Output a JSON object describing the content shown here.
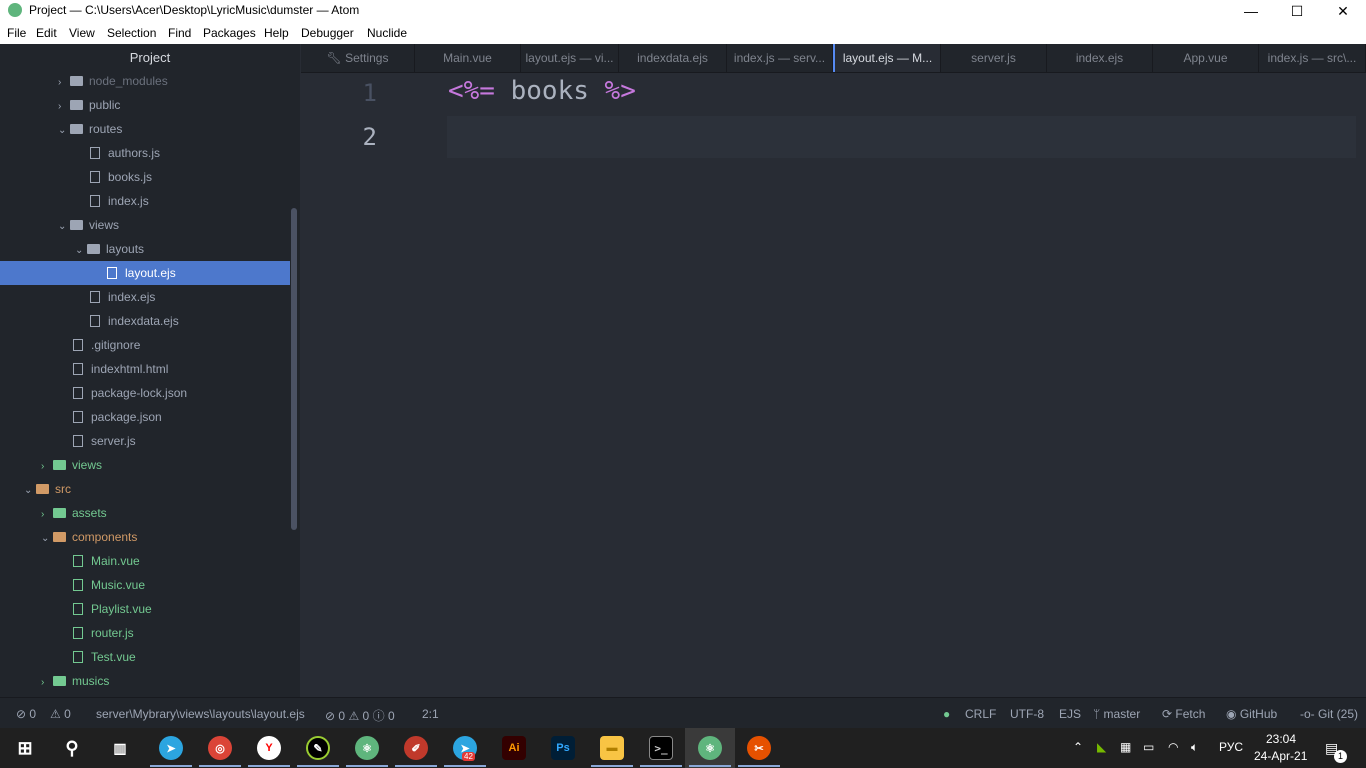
{
  "window": {
    "title": "Project — C:\\Users\\Acer\\Desktop\\LyricMusic\\dumster — Atom",
    "minimize": "—",
    "maximize": "☐",
    "close": "✕"
  },
  "menu": [
    "File",
    "Edit",
    "View",
    "Selection",
    "Find",
    "Packages",
    "Help",
    "Debugger",
    "Nuclide"
  ],
  "sidebar": {
    "title": "Project",
    "items": [
      {
        "label": "node_modules",
        "depth": 3,
        "type": "folder",
        "chev": "›",
        "color": "dim"
      },
      {
        "label": "public",
        "depth": 3,
        "type": "folder",
        "chev": "›"
      },
      {
        "label": "routes",
        "depth": 3,
        "type": "folder",
        "chev": "⌄"
      },
      {
        "label": "authors.js",
        "depth": 4,
        "type": "file"
      },
      {
        "label": "books.js",
        "depth": 4,
        "type": "file"
      },
      {
        "label": "index.js",
        "depth": 4,
        "type": "file"
      },
      {
        "label": "views",
        "depth": 3,
        "type": "folder-open",
        "chev": "⌄"
      },
      {
        "label": "layouts",
        "depth": 4,
        "type": "folder",
        "chev": "⌄"
      },
      {
        "label": "layout.ejs",
        "depth": 5,
        "type": "file",
        "selected": true
      },
      {
        "label": "index.ejs",
        "depth": 4,
        "type": "file"
      },
      {
        "label": "indexdata.ejs",
        "depth": 4,
        "type": "file"
      },
      {
        "label": ".gitignore",
        "depth": 3,
        "type": "file"
      },
      {
        "label": "indexhtml.html",
        "depth": 3,
        "type": "file"
      },
      {
        "label": "package-lock.json",
        "depth": 3,
        "type": "file"
      },
      {
        "label": "package.json",
        "depth": 3,
        "type": "file"
      },
      {
        "label": "server.js",
        "depth": 3,
        "type": "file"
      },
      {
        "label": "views",
        "depth": 2,
        "type": "folder",
        "chev": "›",
        "color": "green"
      },
      {
        "label": "src",
        "depth": 1,
        "type": "folder",
        "chev": "⌄",
        "color": "orange"
      },
      {
        "label": "assets",
        "depth": 2,
        "type": "folder",
        "chev": "›",
        "color": "green"
      },
      {
        "label": "components",
        "depth": 2,
        "type": "folder",
        "chev": "⌄",
        "color": "orange"
      },
      {
        "label": "Main.vue",
        "depth": 3,
        "type": "file",
        "color": "green"
      },
      {
        "label": "Music.vue",
        "depth": 3,
        "type": "file",
        "color": "green"
      },
      {
        "label": "Playlist.vue",
        "depth": 3,
        "type": "file",
        "color": "green"
      },
      {
        "label": "router.js",
        "depth": 3,
        "type": "file",
        "color": "green"
      },
      {
        "label": "Test.vue",
        "depth": 3,
        "type": "file",
        "color": "green"
      },
      {
        "label": "musics",
        "depth": 2,
        "type": "folder",
        "chev": "›",
        "color": "green"
      }
    ]
  },
  "tabs": [
    {
      "label": "Settings",
      "icon": "wrench-icon"
    },
    {
      "label": "Main.vue"
    },
    {
      "label": "layout.ejs — vi..."
    },
    {
      "label": "indexdata.ejs"
    },
    {
      "label": "index.js — serv..."
    },
    {
      "label": "layout.ejs — M...",
      "active": true
    },
    {
      "label": "server.js"
    },
    {
      "label": "index.ejs"
    },
    {
      "label": "App.vue"
    },
    {
      "label": "index.js — src\\..."
    }
  ],
  "editor": {
    "lines": [
      "1",
      "2"
    ],
    "code": {
      "open": "<%=",
      "content": " books ",
      "close": "%>"
    }
  },
  "status": {
    "errors": "0",
    "warnings": "0",
    "path": "server\\Mybrary\\views\\layouts\\layout.ejs",
    "diag_errors": "0",
    "diag_warnings": "0",
    "diag_info": "0",
    "cursor": "2:1",
    "line_ending": "CRLF",
    "encoding": "UTF-8",
    "grammar": "EJS",
    "branch": "master",
    "fetch": "Fetch",
    "github": "GitHub",
    "git": "Git (25)"
  },
  "taskbar": {
    "time": "23:04",
    "date": "24-Apr-21",
    "lang": "РУС",
    "notifications": "1",
    "telegram_badge": "42",
    "illustrator": "Ai",
    "photoshop": "Ps"
  },
  "colors": {
    "accent": "#4d78cc",
    "git_green": "#73c991",
    "git_orange": "#d19a66",
    "keyword_purple": "#c678dd"
  }
}
